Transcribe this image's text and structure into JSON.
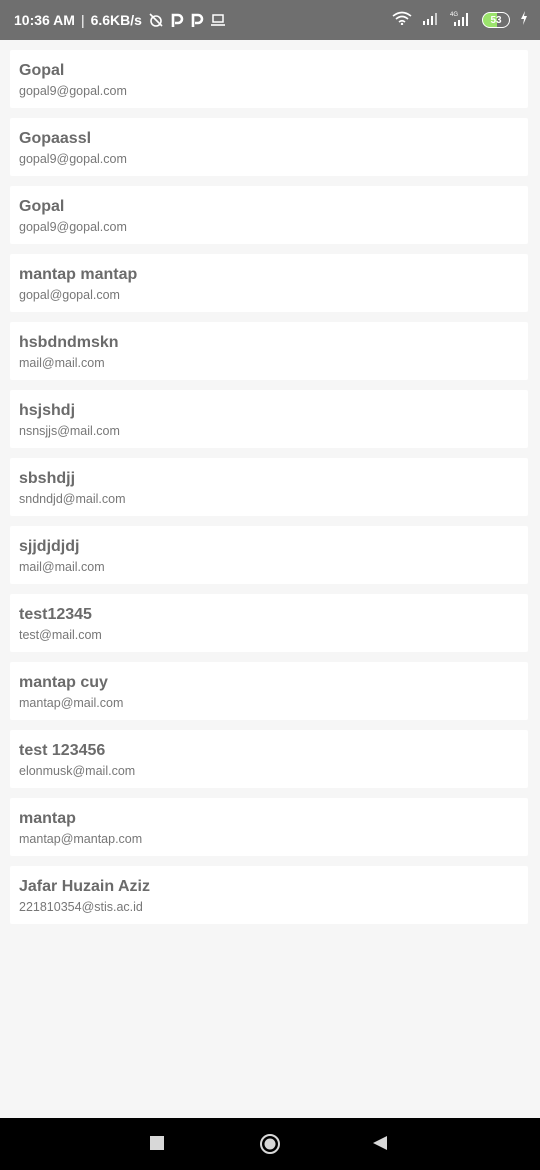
{
  "status_bar": {
    "time": "10:36 AM",
    "separator": "|",
    "net_speed": "6.6KB/s",
    "battery_level": "53",
    "icons": [
      "alarm-off-icon",
      "parking-app-icon",
      "parking-app-icon",
      "laptop-icon",
      "wifi-icon",
      "signal-icon",
      "signal-4g-icon",
      "battery-icon",
      "charging-icon"
    ]
  },
  "users": [
    {
      "name": "Gopal",
      "email": "gopal9@gopal.com"
    },
    {
      "name": "Gopaassl",
      "email": "gopal9@gopal.com"
    },
    {
      "name": "Gopal",
      "email": "gopal9@gopal.com"
    },
    {
      "name": "mantap mantap",
      "email": "gopal@gopal.com"
    },
    {
      "name": "hsbdndmskn",
      "email": "mail@mail.com"
    },
    {
      "name": "hsjshdj",
      "email": "nsnsjjs@mail.com"
    },
    {
      "name": "sbshdjj",
      "email": "sndndjd@mail.com"
    },
    {
      "name": "sjjdjdjdj",
      "email": "mail@mail.com"
    },
    {
      "name": "test12345",
      "email": "test@mail.com"
    },
    {
      "name": "mantap cuy",
      "email": "mantap@mail.com"
    },
    {
      "name": "test 123456",
      "email": "elonmusk@mail.com"
    },
    {
      "name": "mantap",
      "email": "mantap@mantap.com"
    },
    {
      "name": "Jafar Huzain Aziz",
      "email": "221810354@stis.ac.id"
    }
  ],
  "nav_bar": {
    "buttons": [
      "recents-square-icon",
      "home-circle-icon",
      "back-triangle-icon"
    ]
  },
  "colors": {
    "status_bar_bg": "#6f6f6f",
    "page_bg": "#f6f6f6",
    "card_bg": "#ffffff",
    "name_text": "#6b6b6b",
    "email_text": "#777777",
    "battery_fill": "#9be36c"
  }
}
